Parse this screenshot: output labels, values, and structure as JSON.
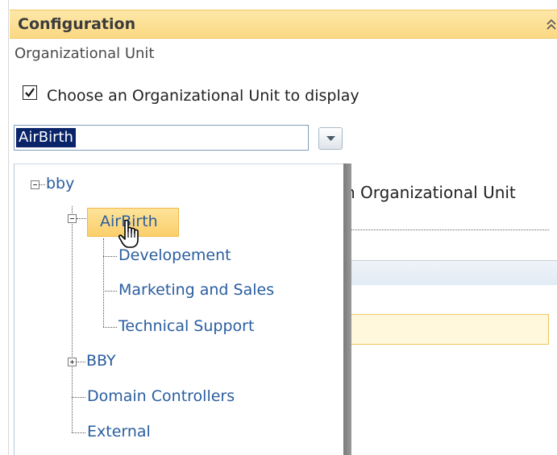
{
  "panel": {
    "title": "Configuration",
    "section_label": "Organizational Unit"
  },
  "option": {
    "checkbox_label": "Choose an Organizational Unit to display",
    "checked": true
  },
  "combo": {
    "value": "AirBirth"
  },
  "background": {
    "partial_text": "n Organizational Unit"
  },
  "tree": {
    "root": "bby",
    "selected": "AirBirth",
    "children_of_selected": [
      "Developement",
      "Marketing and Sales",
      "Technical Support"
    ],
    "siblings": [
      "BBY",
      "Domain Controllers",
      "External"
    ]
  },
  "icons": {
    "collapse": "double-chevron-up-icon",
    "dropdown_arrow": "chevron-down-icon",
    "expand": "plus-box-icon",
    "collapse_node": "minus-box-icon",
    "cursor": "hand-pointer-icon"
  },
  "colors": {
    "header_bg": "#fbd983",
    "tree_link": "#2a5d9f",
    "selection": "#0a246a",
    "highlight": "#fbcf6b"
  }
}
